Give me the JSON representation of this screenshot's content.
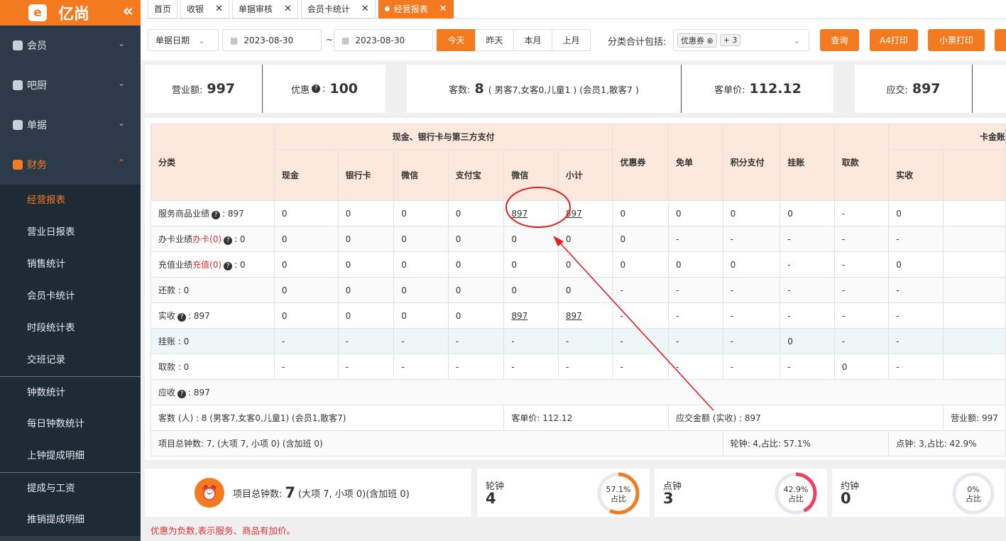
{
  "brand": {
    "name": "亿尚"
  },
  "sidebar": {
    "sections": [
      {
        "label": "会员"
      },
      {
        "label": "吧厨"
      },
      {
        "label": "单据"
      },
      {
        "label": "财务"
      }
    ],
    "items": [
      {
        "label": "经营报表"
      },
      {
        "label": "营业日报表"
      },
      {
        "label": "销售统计"
      },
      {
        "label": "会员卡统计"
      },
      {
        "label": "时段统计表"
      },
      {
        "label": "交班记录"
      },
      {
        "label": "钟数统计"
      },
      {
        "label": "每日钟数统计"
      },
      {
        "label": "上钟提成明细"
      },
      {
        "label": "提成与工资"
      },
      {
        "label": "推销提成明细"
      }
    ]
  },
  "tabs": [
    {
      "label": "首页"
    },
    {
      "label": "收银"
    },
    {
      "label": "单据审核"
    },
    {
      "label": "会员卡统计"
    },
    {
      "label": "经营报表"
    }
  ],
  "filter": {
    "date_type": "单据日期",
    "date_from": "2023-08-30",
    "tilde": "~",
    "date_to": "2023-08-30",
    "quick": [
      "今天",
      "昨天",
      "本月",
      "上月"
    ],
    "include_label": "分类合计包括:",
    "chip": "优惠券",
    "chip_more": "+ 3",
    "query": "查询",
    "print_a4": "A4打印",
    "print_ticket": "小票打印"
  },
  "summary": {
    "revenue_label": "营业额:",
    "revenue": "997",
    "discount_label": "优惠",
    "discount_suffix": ":",
    "discount": "100",
    "guests_label": "客数:",
    "guests": "8",
    "guests_detail": "( 男客7,女客0,儿童1 ) (会员1,散客7 )",
    "avg_label": "客单价:",
    "avg": "112.12",
    "due_label": "应交:",
    "due": "897"
  },
  "table": {
    "category_header": "分类",
    "group_cash": "现金、银行卡与第三方支付",
    "cols_cash": [
      "现金",
      "银行卡",
      "微信",
      "支付宝",
      "微信",
      "小计"
    ],
    "cols_other": [
      "优惠券",
      "免单",
      "积分支付",
      "挂账",
      "取款"
    ],
    "group_card": "卡金账",
    "col_card_paid": "实收",
    "rows": [
      {
        "label": "服务商品业绩",
        "suffix": ": 897",
        "cells": [
          "0",
          "0",
          "0",
          "0",
          "897",
          "897",
          "0",
          "0",
          "0",
          "0",
          "-",
          "0"
        ]
      },
      {
        "label": "办卡业绩",
        "red": "办卡(0)",
        "suffix": ": 0",
        "cells": [
          "0",
          "0",
          "0",
          "0",
          "0",
          "0",
          "0",
          "-",
          "-",
          "-",
          "-",
          "-"
        ]
      },
      {
        "label": "充值业绩",
        "red": "充值(0)",
        "suffix": ": 0",
        "cells": [
          "0",
          "0",
          "0",
          "0",
          "0",
          "0",
          "0",
          "0",
          "0",
          "-",
          "-",
          "0"
        ]
      },
      {
        "label": "还款 : 0",
        "cells": [
          "0",
          "0",
          "0",
          "0",
          "0",
          "0",
          "-",
          "-",
          "-",
          "-",
          "-",
          "-"
        ]
      },
      {
        "label": "实收",
        "suffix": ": 897",
        "cells": [
          "0",
          "0",
          "0",
          "0",
          "897",
          "897",
          "-",
          "-",
          "-",
          "-",
          "-",
          "-"
        ]
      },
      {
        "label": "挂账 : 0",
        "cells": [
          "-",
          "-",
          "-",
          "-",
          "-",
          "-",
          "-",
          "-",
          "-",
          "0",
          "-",
          "-"
        ]
      },
      {
        "label": "取款 : 0",
        "cells": [
          "-",
          "-",
          "-",
          "-",
          "-",
          "-",
          "-",
          "-",
          "-",
          "-",
          "0",
          "-"
        ]
      }
    ],
    "receivable_label": "应收",
    "receivable_suffix": ": 897",
    "guests_row": "客数 (人) : 8 (男客7,女客0,儿童1)  (会员1,散客7)",
    "avg_row": "客单价: 112.12",
    "due_row": "应交金额 (实收) : 897",
    "revenue_row": "营业额: 997",
    "hours_row": "项目总钟数: 7, (大项 7, 小项 0)  (含加班 0)",
    "turn_row": "轮钟: 4,占比: 57.1%",
    "point_row": "点钟: 3,占比: 42.9%"
  },
  "bottom": {
    "total_label": "项目总钟数:",
    "total": "7",
    "total_detail": "(大项 7, 小项 0)(含加班 0)",
    "turn": {
      "label": "轮钟",
      "value": "4",
      "pct": "57.1%",
      "pct_label": "占比",
      "ratio": 0.571,
      "color": "#f47a20"
    },
    "point": {
      "label": "点钟",
      "value": "3",
      "pct": "42.9%",
      "pct_label": "占比",
      "ratio": 0.429,
      "color": "#f04060"
    },
    "appoint": {
      "label": "约钟",
      "value": "0",
      "pct": "0%",
      "pct_label": "占比",
      "ratio": 0,
      "color": "#999999"
    }
  },
  "note": "优惠为负数,表示服务、商品有加价。"
}
